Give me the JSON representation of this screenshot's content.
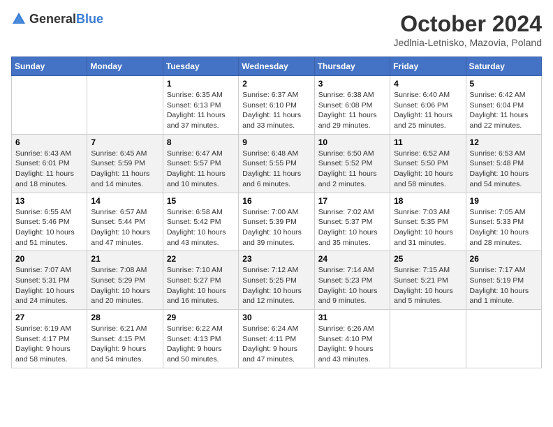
{
  "logo": {
    "text_general": "General",
    "text_blue": "Blue"
  },
  "calendar": {
    "title": "October 2024",
    "subtitle": "Jedlnia-Letnisko, Mazovia, Poland",
    "days_of_week": [
      "Sunday",
      "Monday",
      "Tuesday",
      "Wednesday",
      "Thursday",
      "Friday",
      "Saturday"
    ],
    "weeks": [
      [
        {
          "day": "",
          "info": ""
        },
        {
          "day": "",
          "info": ""
        },
        {
          "day": "1",
          "info": "Sunrise: 6:35 AM\nSunset: 6:13 PM\nDaylight: 11 hours and 37 minutes."
        },
        {
          "day": "2",
          "info": "Sunrise: 6:37 AM\nSunset: 6:10 PM\nDaylight: 11 hours and 33 minutes."
        },
        {
          "day": "3",
          "info": "Sunrise: 6:38 AM\nSunset: 6:08 PM\nDaylight: 11 hours and 29 minutes."
        },
        {
          "day": "4",
          "info": "Sunrise: 6:40 AM\nSunset: 6:06 PM\nDaylight: 11 hours and 25 minutes."
        },
        {
          "day": "5",
          "info": "Sunrise: 6:42 AM\nSunset: 6:04 PM\nDaylight: 11 hours and 22 minutes."
        }
      ],
      [
        {
          "day": "6",
          "info": "Sunrise: 6:43 AM\nSunset: 6:01 PM\nDaylight: 11 hours and 18 minutes."
        },
        {
          "day": "7",
          "info": "Sunrise: 6:45 AM\nSunset: 5:59 PM\nDaylight: 11 hours and 14 minutes."
        },
        {
          "day": "8",
          "info": "Sunrise: 6:47 AM\nSunset: 5:57 PM\nDaylight: 11 hours and 10 minutes."
        },
        {
          "day": "9",
          "info": "Sunrise: 6:48 AM\nSunset: 5:55 PM\nDaylight: 11 hours and 6 minutes."
        },
        {
          "day": "10",
          "info": "Sunrise: 6:50 AM\nSunset: 5:52 PM\nDaylight: 11 hours and 2 minutes."
        },
        {
          "day": "11",
          "info": "Sunrise: 6:52 AM\nSunset: 5:50 PM\nDaylight: 10 hours and 58 minutes."
        },
        {
          "day": "12",
          "info": "Sunrise: 6:53 AM\nSunset: 5:48 PM\nDaylight: 10 hours and 54 minutes."
        }
      ],
      [
        {
          "day": "13",
          "info": "Sunrise: 6:55 AM\nSunset: 5:46 PM\nDaylight: 10 hours and 51 minutes."
        },
        {
          "day": "14",
          "info": "Sunrise: 6:57 AM\nSunset: 5:44 PM\nDaylight: 10 hours and 47 minutes."
        },
        {
          "day": "15",
          "info": "Sunrise: 6:58 AM\nSunset: 5:42 PM\nDaylight: 10 hours and 43 minutes."
        },
        {
          "day": "16",
          "info": "Sunrise: 7:00 AM\nSunset: 5:39 PM\nDaylight: 10 hours and 39 minutes."
        },
        {
          "day": "17",
          "info": "Sunrise: 7:02 AM\nSunset: 5:37 PM\nDaylight: 10 hours and 35 minutes."
        },
        {
          "day": "18",
          "info": "Sunrise: 7:03 AM\nSunset: 5:35 PM\nDaylight: 10 hours and 31 minutes."
        },
        {
          "day": "19",
          "info": "Sunrise: 7:05 AM\nSunset: 5:33 PM\nDaylight: 10 hours and 28 minutes."
        }
      ],
      [
        {
          "day": "20",
          "info": "Sunrise: 7:07 AM\nSunset: 5:31 PM\nDaylight: 10 hours and 24 minutes."
        },
        {
          "day": "21",
          "info": "Sunrise: 7:08 AM\nSunset: 5:29 PM\nDaylight: 10 hours and 20 minutes."
        },
        {
          "day": "22",
          "info": "Sunrise: 7:10 AM\nSunset: 5:27 PM\nDaylight: 10 hours and 16 minutes."
        },
        {
          "day": "23",
          "info": "Sunrise: 7:12 AM\nSunset: 5:25 PM\nDaylight: 10 hours and 12 minutes."
        },
        {
          "day": "24",
          "info": "Sunrise: 7:14 AM\nSunset: 5:23 PM\nDaylight: 10 hours and 9 minutes."
        },
        {
          "day": "25",
          "info": "Sunrise: 7:15 AM\nSunset: 5:21 PM\nDaylight: 10 hours and 5 minutes."
        },
        {
          "day": "26",
          "info": "Sunrise: 7:17 AM\nSunset: 5:19 PM\nDaylight: 10 hours and 1 minute."
        }
      ],
      [
        {
          "day": "27",
          "info": "Sunrise: 6:19 AM\nSunset: 4:17 PM\nDaylight: 9 hours and 58 minutes."
        },
        {
          "day": "28",
          "info": "Sunrise: 6:21 AM\nSunset: 4:15 PM\nDaylight: 9 hours and 54 minutes."
        },
        {
          "day": "29",
          "info": "Sunrise: 6:22 AM\nSunset: 4:13 PM\nDaylight: 9 hours and 50 minutes."
        },
        {
          "day": "30",
          "info": "Sunrise: 6:24 AM\nSunset: 4:11 PM\nDaylight: 9 hours and 47 minutes."
        },
        {
          "day": "31",
          "info": "Sunrise: 6:26 AM\nSunset: 4:10 PM\nDaylight: 9 hours and 43 minutes."
        },
        {
          "day": "",
          "info": ""
        },
        {
          "day": "",
          "info": ""
        }
      ]
    ]
  }
}
